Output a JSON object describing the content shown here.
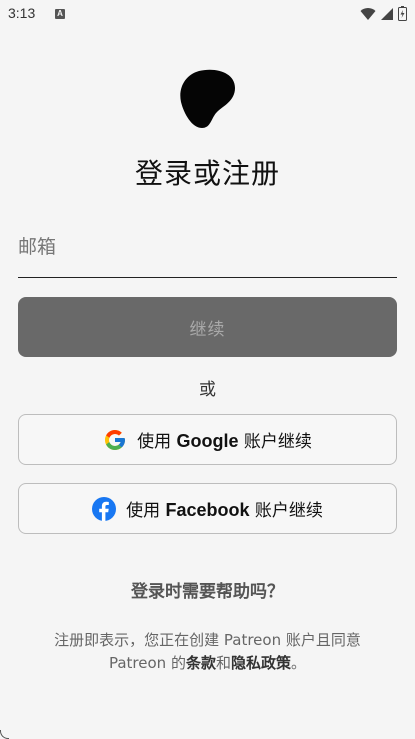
{
  "status_bar": {
    "time": "3:13",
    "notification_icon_letter": "A",
    "icons": [
      "wifi-icon",
      "signal-icon",
      "battery-icon"
    ]
  },
  "header": {
    "title": "登录或注册"
  },
  "email": {
    "placeholder": "邮箱",
    "value": ""
  },
  "continue_button": {
    "label": "继续"
  },
  "divider": {
    "or_text": "或"
  },
  "google_button": {
    "prefix": "使用",
    "brand": "Google",
    "suffix": "账户继续"
  },
  "facebook_button": {
    "prefix": "使用",
    "brand": "Facebook",
    "suffix": "账户继续"
  },
  "help": {
    "label": "登录时需要帮助吗？"
  },
  "legal": {
    "line1": "注册即表示，您正在创建 Patreon 账户且同意",
    "line2_prefix": "Patreon 的",
    "terms_link": "条款",
    "conjunction": "和",
    "privacy_link": "隐私政策",
    "end": "。"
  },
  "colors": {
    "background": "#f5f5f5",
    "continue_button_bg": "#696969",
    "continue_button_text": "#a9a9a9",
    "facebook_blue": "#1877f2",
    "google_blue": "#4285f4",
    "google_red": "#ea4335",
    "google_yellow": "#fbbc05",
    "google_green": "#34a853"
  }
}
